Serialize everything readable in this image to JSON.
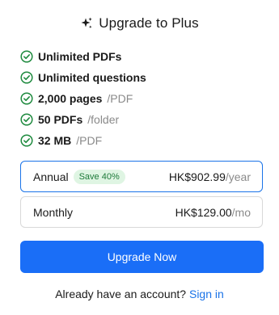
{
  "header": {
    "title": "Upgrade to Plus",
    "icon": "sparkle-icon"
  },
  "features": [
    {
      "main": "Unlimited PDFs",
      "sub": ""
    },
    {
      "main": "Unlimited questions",
      "sub": ""
    },
    {
      "main": "2,000 pages",
      "sub": "/PDF"
    },
    {
      "main": "50 PDFs",
      "sub": "/folder"
    },
    {
      "main": "32 MB",
      "sub": "/PDF"
    }
  ],
  "plans": {
    "annual": {
      "name": "Annual",
      "badge": "Save 40%",
      "price": "HK$902.99",
      "per": "/year",
      "selected": true
    },
    "monthly": {
      "name": "Monthly",
      "badge": "",
      "price": "HK$129.00",
      "per": "/mo",
      "selected": false
    }
  },
  "cta": {
    "label": "Upgrade Now"
  },
  "footer": {
    "text": "Already have an account?",
    "link": "Sign in"
  },
  "colors": {
    "accent": "#1a6ef7",
    "check": "#1e8a3e",
    "badge_bg": "#dff5e3",
    "muted": "#8a8a8a"
  }
}
